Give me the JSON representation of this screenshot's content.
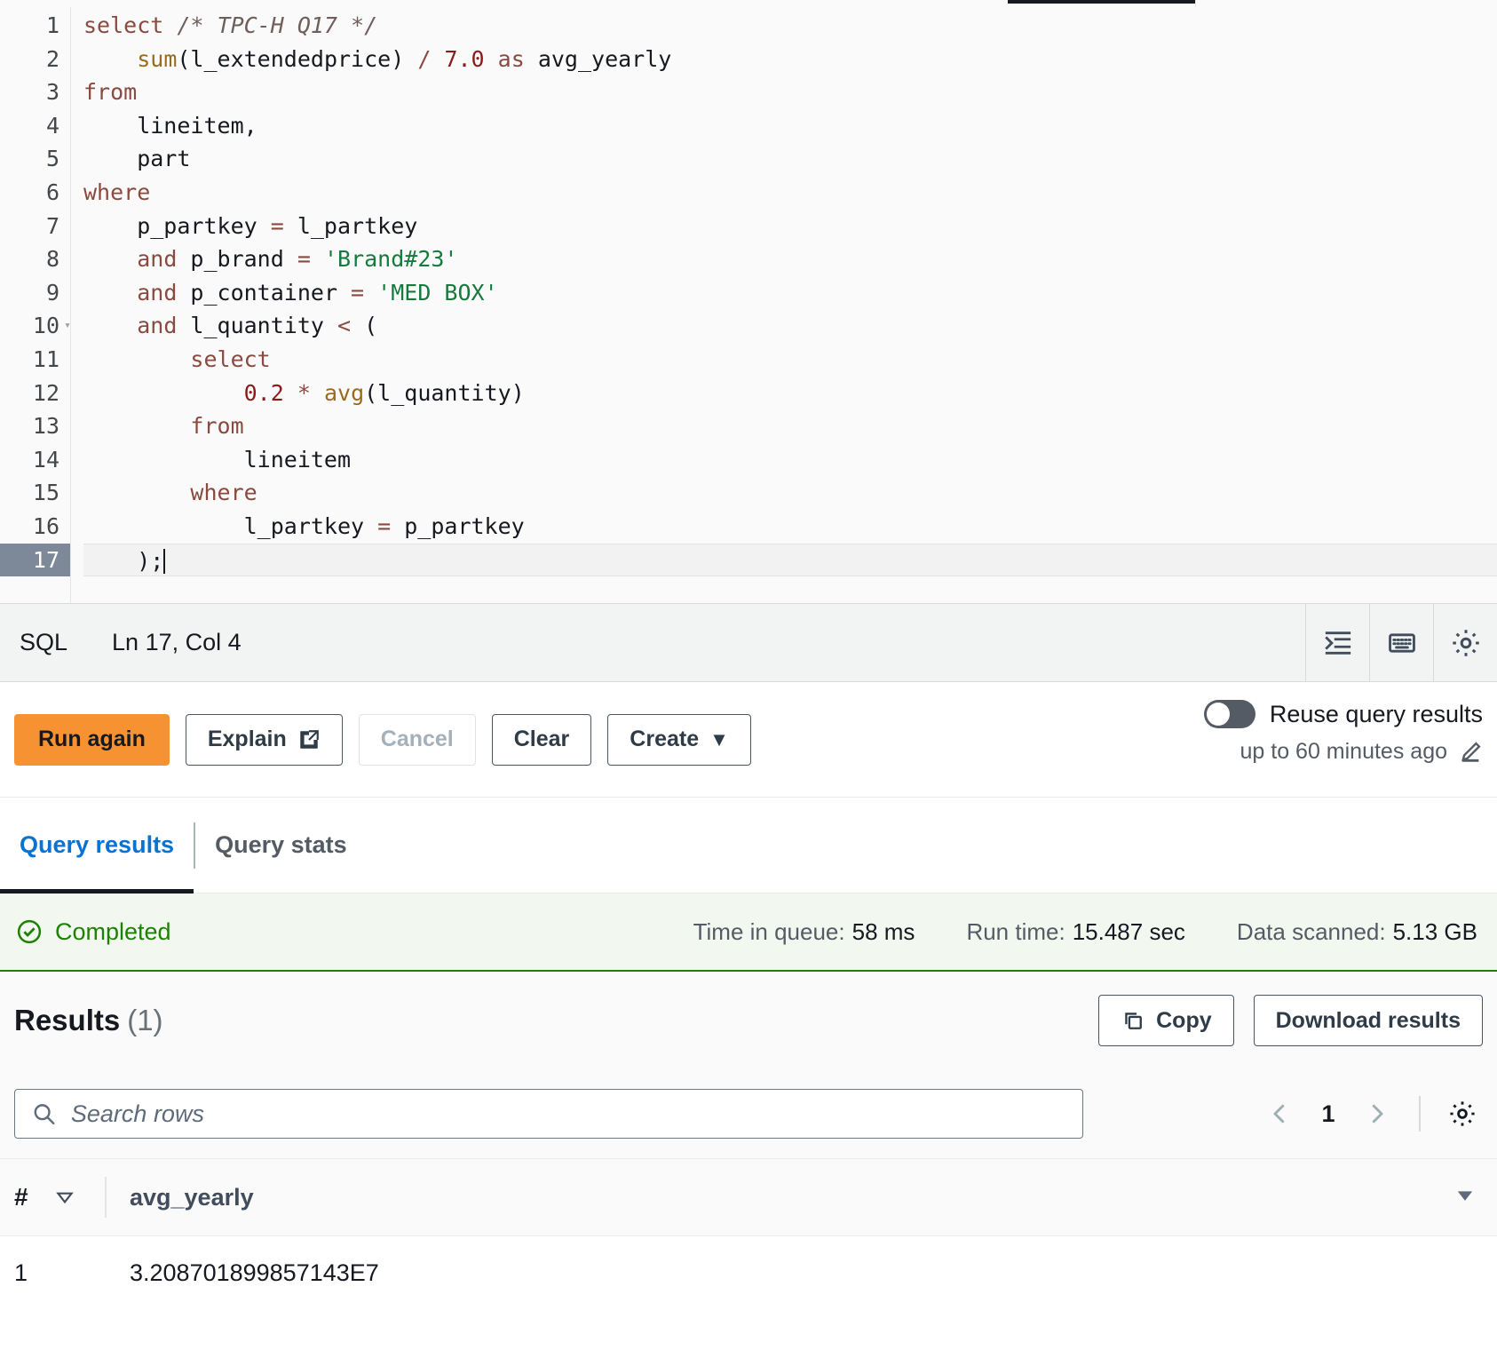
{
  "editor": {
    "language": "SQL",
    "cursor_position": "Ln 17, Col 4",
    "lines": [
      {
        "n": "1",
        "tokens": [
          {
            "t": "select ",
            "c": "kw"
          },
          {
            "t": "/* TPC-H Q17 */",
            "c": "cmt"
          }
        ]
      },
      {
        "n": "2",
        "tokens": [
          {
            "t": "    ",
            "c": ""
          },
          {
            "t": "sum",
            "c": "fn"
          },
          {
            "t": "(l_extendedprice) ",
            "c": ""
          },
          {
            "t": "/",
            "c": "op"
          },
          {
            "t": " ",
            "c": ""
          },
          {
            "t": "7.0",
            "c": "num"
          },
          {
            "t": " ",
            "c": ""
          },
          {
            "t": "as",
            "c": "kw"
          },
          {
            "t": " avg_yearly",
            "c": ""
          }
        ]
      },
      {
        "n": "3",
        "tokens": [
          {
            "t": "from",
            "c": "kw"
          }
        ]
      },
      {
        "n": "4",
        "tokens": [
          {
            "t": "    lineitem,",
            "c": ""
          }
        ]
      },
      {
        "n": "5",
        "tokens": [
          {
            "t": "    part",
            "c": ""
          }
        ]
      },
      {
        "n": "6",
        "tokens": [
          {
            "t": "where",
            "c": "kw"
          }
        ]
      },
      {
        "n": "7",
        "tokens": [
          {
            "t": "    p_partkey ",
            "c": ""
          },
          {
            "t": "=",
            "c": "op"
          },
          {
            "t": " l_partkey",
            "c": ""
          }
        ]
      },
      {
        "n": "8",
        "tokens": [
          {
            "t": "    ",
            "c": ""
          },
          {
            "t": "and",
            "c": "kw"
          },
          {
            "t": " p_brand ",
            "c": ""
          },
          {
            "t": "=",
            "c": "op"
          },
          {
            "t": " ",
            "c": ""
          },
          {
            "t": "'Brand#23'",
            "c": "str"
          }
        ]
      },
      {
        "n": "9",
        "tokens": [
          {
            "t": "    ",
            "c": ""
          },
          {
            "t": "and",
            "c": "kw"
          },
          {
            "t": " p_container ",
            "c": ""
          },
          {
            "t": "=",
            "c": "op"
          },
          {
            "t": " ",
            "c": ""
          },
          {
            "t": "'MED BOX'",
            "c": "str"
          }
        ]
      },
      {
        "n": "10",
        "fold": true,
        "tokens": [
          {
            "t": "    ",
            "c": ""
          },
          {
            "t": "and",
            "c": "kw"
          },
          {
            "t": " l_quantity ",
            "c": ""
          },
          {
            "t": "<",
            "c": "op"
          },
          {
            "t": " (",
            "c": ""
          }
        ]
      },
      {
        "n": "11",
        "tokens": [
          {
            "t": "        ",
            "c": ""
          },
          {
            "t": "select",
            "c": "kw"
          }
        ]
      },
      {
        "n": "12",
        "tokens": [
          {
            "t": "            ",
            "c": ""
          },
          {
            "t": "0.2",
            "c": "num"
          },
          {
            "t": " ",
            "c": ""
          },
          {
            "t": "*",
            "c": "op"
          },
          {
            "t": " ",
            "c": ""
          },
          {
            "t": "avg",
            "c": "fn"
          },
          {
            "t": "(l_quantity)",
            "c": ""
          }
        ]
      },
      {
        "n": "13",
        "tokens": [
          {
            "t": "        ",
            "c": ""
          },
          {
            "t": "from",
            "c": "kw"
          }
        ]
      },
      {
        "n": "14",
        "tokens": [
          {
            "t": "            lineitem",
            "c": ""
          }
        ]
      },
      {
        "n": "15",
        "tokens": [
          {
            "t": "        ",
            "c": ""
          },
          {
            "t": "where",
            "c": "kw"
          }
        ]
      },
      {
        "n": "16",
        "tokens": [
          {
            "t": "            l_partkey ",
            "c": ""
          },
          {
            "t": "=",
            "c": "op"
          },
          {
            "t": " p_partkey",
            "c": ""
          }
        ]
      },
      {
        "n": "17",
        "active": true,
        "tokens": [
          {
            "t": "    );",
            "c": ""
          }
        ]
      }
    ],
    "toolbar_icons": [
      "format-indent-icon",
      "keyboard-shortcuts-icon",
      "editor-settings-gear-icon"
    ]
  },
  "actions": {
    "run_again": "Run again",
    "explain": "Explain",
    "cancel": "Cancel",
    "clear": "Clear",
    "create": "Create",
    "create_caret": "▼"
  },
  "reuse": {
    "label": "Reuse query results",
    "sublabel": "up to 60 minutes ago",
    "enabled": false
  },
  "tabs": [
    {
      "label": "Query results",
      "active": true
    },
    {
      "label": "Query stats",
      "active": false
    }
  ],
  "status": {
    "state": "Completed",
    "color": "#1d8102",
    "metrics": [
      {
        "label": "Time in queue:",
        "value": "58 ms"
      },
      {
        "label": "Run time:",
        "value": "15.487 sec"
      },
      {
        "label": "Data scanned:",
        "value": "5.13 GB"
      }
    ]
  },
  "results": {
    "title": "Results",
    "count": "(1)",
    "copy_label": "Copy",
    "download_label": "Download results",
    "search_placeholder": "Search rows",
    "search_value": "",
    "page": "1",
    "columns": [
      "#",
      "avg_yearly"
    ],
    "rows": [
      {
        "idx": "1",
        "avg_yearly": "3.208701899857143E7"
      }
    ]
  },
  "colors": {
    "accent_orange": "#f79232",
    "link_blue": "#0972d3",
    "success_green": "#1d8102",
    "dark": "#16191f"
  }
}
